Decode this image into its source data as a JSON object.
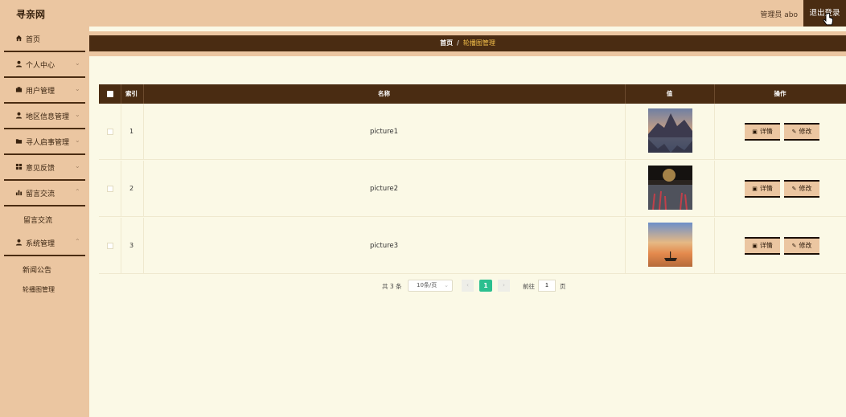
{
  "header": {
    "brand": "寻亲网",
    "admin_label": "管理员 abo",
    "logout_label": "退出登录"
  },
  "sidebar": {
    "items": [
      {
        "icon": "home-icon",
        "label": "首页"
      },
      {
        "icon": "user-icon",
        "label": "个人中心"
      },
      {
        "icon": "users-icon",
        "label": "用户管理"
      },
      {
        "icon": "user-icon",
        "label": "地区信息管理"
      },
      {
        "icon": "folder-icon",
        "label": "寻人启事管理"
      },
      {
        "icon": "grid-icon",
        "label": "意见反馈"
      },
      {
        "icon": "bar-chart-icon",
        "label": "留言交流"
      },
      {
        "icon": "user-icon",
        "label": "系统管理"
      }
    ],
    "subitems": {
      "liuyan": "留言交流",
      "news": "新闻公告",
      "carousel": "轮播图管理"
    }
  },
  "breadcrumb": {
    "home": "首页",
    "separator": "/",
    "current": "轮播图管理"
  },
  "table": {
    "headers": {
      "index": "索引",
      "name": "名称",
      "value": "值",
      "actions": "操作"
    },
    "rows": [
      {
        "index": "1",
        "name": "picture1"
      },
      {
        "index": "2",
        "name": "picture2"
      },
      {
        "index": "3",
        "name": "picture3"
      }
    ],
    "detail_label": "详情",
    "edit_label": "修改"
  },
  "pagination": {
    "total": "共 3 条",
    "page_size": "10条/页",
    "prev": "‹",
    "next": "›",
    "current_page": "1",
    "goto_label": "前往",
    "goto_value": "1",
    "page_suffix": "页"
  },
  "colors": {
    "accent_dark": "#4a2c12",
    "accent_light": "#ebc6a1",
    "page_bg": "#fbf9e6",
    "active_page": "#2bbf8f"
  }
}
